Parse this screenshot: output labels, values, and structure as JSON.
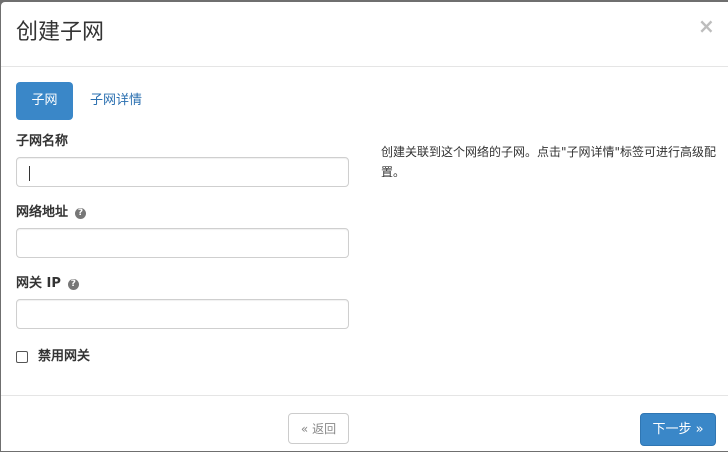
{
  "dialog": {
    "title": "创建子网",
    "close_glyph": "×"
  },
  "tabs": [
    {
      "label": "子网",
      "active": true
    },
    {
      "label": "子网详情",
      "active": false
    }
  ],
  "form": {
    "subnet_name": {
      "label": "子网名称",
      "value": ""
    },
    "network_address": {
      "label": "网络地址",
      "value": ""
    },
    "gateway_ip": {
      "label": "网关 IP",
      "value": ""
    },
    "disable_gateway": {
      "label": "禁用网关",
      "checked": false
    }
  },
  "help_text": "创建关联到这个网络的子网。点击\"子网详情\"标签可进行高级配置。",
  "footer": {
    "back_label": "« 返回",
    "next_label": "下一步 »"
  },
  "colors": {
    "primary": "#3a87c8",
    "link": "#2a6fb0"
  },
  "icons": {
    "help": "question-circle-icon",
    "close": "close-icon"
  }
}
